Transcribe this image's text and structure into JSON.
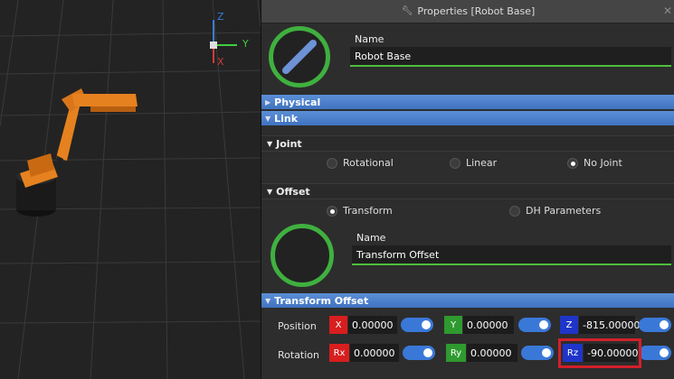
{
  "viewport": {
    "axis_labels": {
      "z": "Z",
      "y": "Y",
      "x": "X"
    },
    "colors": {
      "z_axis": "#3a7bd5",
      "y_axis": "#3fcf3f",
      "x_axis": "#d23a3a",
      "robot": "#e5821f"
    }
  },
  "panel": {
    "title": "Properties [Robot Base]",
    "close_label": "✕",
    "name_label": "Name",
    "name_value": "Robot Base",
    "sections": {
      "physical": "Physical",
      "link": "Link",
      "joint": "Joint",
      "offset": "Offset",
      "transform_offset": "Transform Offset"
    },
    "joint_options": [
      {
        "label": "Rotational",
        "selected": false
      },
      {
        "label": "Linear",
        "selected": false
      },
      {
        "label": "No Joint",
        "selected": true
      }
    ],
    "offset_options": [
      {
        "label": "Transform",
        "selected": true
      },
      {
        "label": "DH Parameters",
        "selected": false
      }
    ],
    "offset_name_label": "Name",
    "offset_name_value": "Transform Offset",
    "position": {
      "label": "Position",
      "x": {
        "axis": "X",
        "value": "0.00000",
        "color": "#d81e1e"
      },
      "y": {
        "axis": "Y",
        "value": "0.00000",
        "color": "#2f9a2f"
      },
      "z": {
        "axis": "Z",
        "value": "-815.00000",
        "color": "#1f35c9"
      }
    },
    "rotation": {
      "label": "Rotation",
      "rx": {
        "axis": "Rx",
        "value": "0.00000",
        "color": "#d81e1e"
      },
      "ry": {
        "axis": "Ry",
        "value": "0.00000",
        "color": "#2f9a2f"
      },
      "rz": {
        "axis": "Rz",
        "value": "-90.00000",
        "color": "#1f35c9"
      }
    },
    "colors": {
      "accent_green": "#4cc03a",
      "section_blue": "#4a80cc",
      "toggle_blue": "#3a78d8",
      "highlight_red": "#d3202a"
    }
  }
}
